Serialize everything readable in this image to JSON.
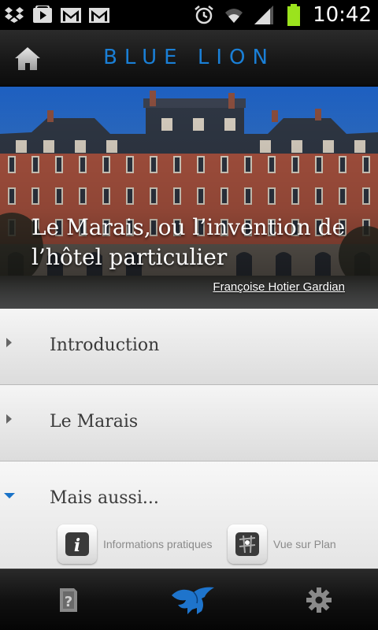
{
  "status_bar": {
    "time": "10:42",
    "left_icons": [
      "dropbox-icon",
      "play-store-icon",
      "gmail-icon",
      "gmail-icon"
    ],
    "right_icons": [
      "alarm-icon",
      "wifi-icon",
      "signal-icon",
      "battery-icon"
    ]
  },
  "header": {
    "title": "BLUE LION",
    "title_color": "#1a7fd6"
  },
  "hero": {
    "title": "Le Marais, ou l’invention de l’hôtel particulier",
    "credit": "Françoise Hotier Gardian"
  },
  "list": {
    "items": [
      {
        "label": "Introduction",
        "expanded": false
      },
      {
        "label": "Le Marais",
        "expanded": false
      },
      {
        "label": "Mais aussi...",
        "expanded": true
      }
    ],
    "sub_items": [
      {
        "label": "Informations pratiques",
        "icon": "info-icon"
      },
      {
        "label": "Vue sur Plan",
        "icon": "map-icon"
      }
    ],
    "accent": "#1a73c8"
  },
  "bottom_bar": {
    "tabs": [
      "guide-icon",
      "blue-lion-logo-icon",
      "settings-icon"
    ]
  }
}
